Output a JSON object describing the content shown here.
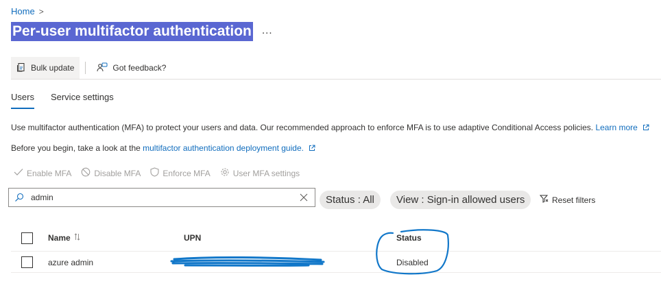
{
  "breadcrumb": {
    "home": "Home",
    "separator": ">"
  },
  "page": {
    "title": "Per-user multifactor authentication",
    "more": "..."
  },
  "commands": {
    "bulk_update": "Bulk update",
    "feedback": "Got feedback?"
  },
  "tabs": [
    {
      "label": "Users",
      "selected": true
    },
    {
      "label": "Service settings",
      "selected": false
    }
  ],
  "info": {
    "line1_text": "Use multifactor authentication (MFA) to protect your users and data. Our recommended approach to enforce MFA is to use adaptive Conditional Access policies.",
    "line1_link": "Learn more",
    "line2_prefix": "Before you begin, take a look at the",
    "line2_link": "multifactor authentication deployment guide."
  },
  "actions": {
    "enable": "Enable MFA",
    "disable": "Disable MFA",
    "enforce": "Enforce MFA",
    "settings": "User MFA settings"
  },
  "search": {
    "value": "admin"
  },
  "filters": {
    "status": "Status : All",
    "view": "View : Sign-in allowed users",
    "reset": "Reset filters"
  },
  "table": {
    "columns": {
      "name": "Name",
      "upn": "UPN",
      "status": "Status"
    },
    "rows": [
      {
        "name": "azure admin",
        "upn": "",
        "status": "Disabled"
      }
    ]
  },
  "colors": {
    "accent": "#0f6cbd",
    "title_highlight": "#5a67d2",
    "annotation": "#1177c9"
  }
}
